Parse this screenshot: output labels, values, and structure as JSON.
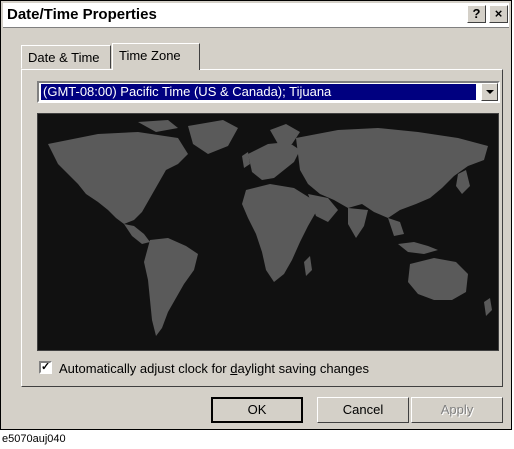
{
  "window": {
    "title": "Date/Time Properties",
    "help_label": "?",
    "close_label": "×"
  },
  "tabs": [
    {
      "label": "Date & Time"
    },
    {
      "label": "Time Zone"
    }
  ],
  "timezone": {
    "selected": "(GMT-08:00) Pacific Time (US & Canada); Tijuana"
  },
  "daylight": {
    "checked": true,
    "label_pre": "Automatically adjust clock for ",
    "label_key": "d",
    "label_post": "aylight saving changes",
    "check_glyph": "✓"
  },
  "buttons": {
    "ok": "OK",
    "cancel": "Cancel",
    "apply": "Apply"
  },
  "caption": "e5070auj040",
  "colors": {
    "map_bg": "#111111",
    "land": "#5a5a5a",
    "selection": "#000080",
    "dialog": "#d4d0c8"
  }
}
